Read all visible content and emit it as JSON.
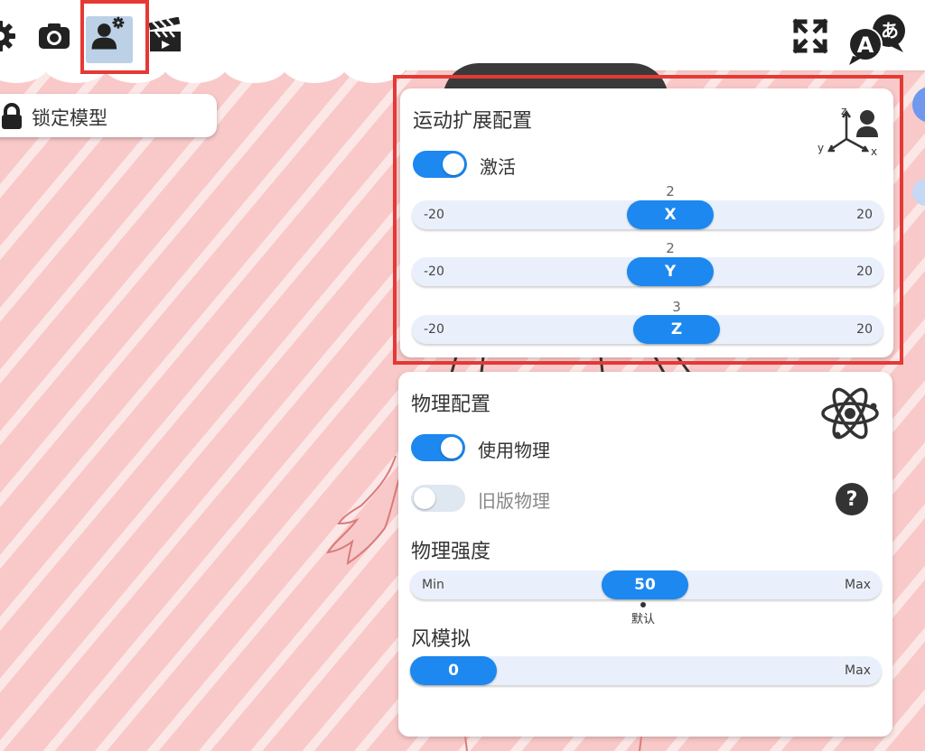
{
  "toolbar": {
    "icons": [
      "gear-icon",
      "camera-icon",
      "user-settings-icon",
      "clapperboard-icon"
    ],
    "right_icons": [
      "fullscreen-icon",
      "language-icon"
    ],
    "language_icon": {
      "latin": "A",
      "kana": "あ"
    }
  },
  "left_panel": {
    "lock_button_label": "锁定模型",
    "lock_icon": "lock-icon"
  },
  "motion_panel": {
    "title": "运动扩展配置",
    "icon": "xyz-person-icon",
    "axis_labels": {
      "z": "z",
      "y": "y",
      "x": "x"
    },
    "activate_label": "激活",
    "activate_on": true,
    "sliders": [
      {
        "axis": "X",
        "min_label": "-20",
        "max_label": "20",
        "value": "2",
        "min": -20,
        "max": 20,
        "current": 2
      },
      {
        "axis": "Y",
        "min_label": "-20",
        "max_label": "20",
        "value": "2",
        "min": -20,
        "max": 20,
        "current": 2
      },
      {
        "axis": "Z",
        "min_label": "-20",
        "max_label": "20",
        "value": "3",
        "min": -20,
        "max": 20,
        "current": 3
      }
    ]
  },
  "physics_panel": {
    "title": "物理配置",
    "icon": "atom-icon",
    "use_physics_label": "使用物理",
    "use_physics_on": true,
    "legacy_physics_label": "旧版物理",
    "legacy_physics_on": false,
    "help_label": "?",
    "strength_title": "物理强度",
    "strength": {
      "min_label": "Min",
      "max_label": "Max",
      "value": "50",
      "fraction": 0.5
    },
    "default_label": "默认",
    "wind_title": "风模拟",
    "wind": {
      "max_label": "Max",
      "value": "0",
      "fraction": 0
    }
  },
  "colors": {
    "accent": "#1c88f0",
    "highlight_frame": "#e53935",
    "background": "#f9c9c9"
  }
}
